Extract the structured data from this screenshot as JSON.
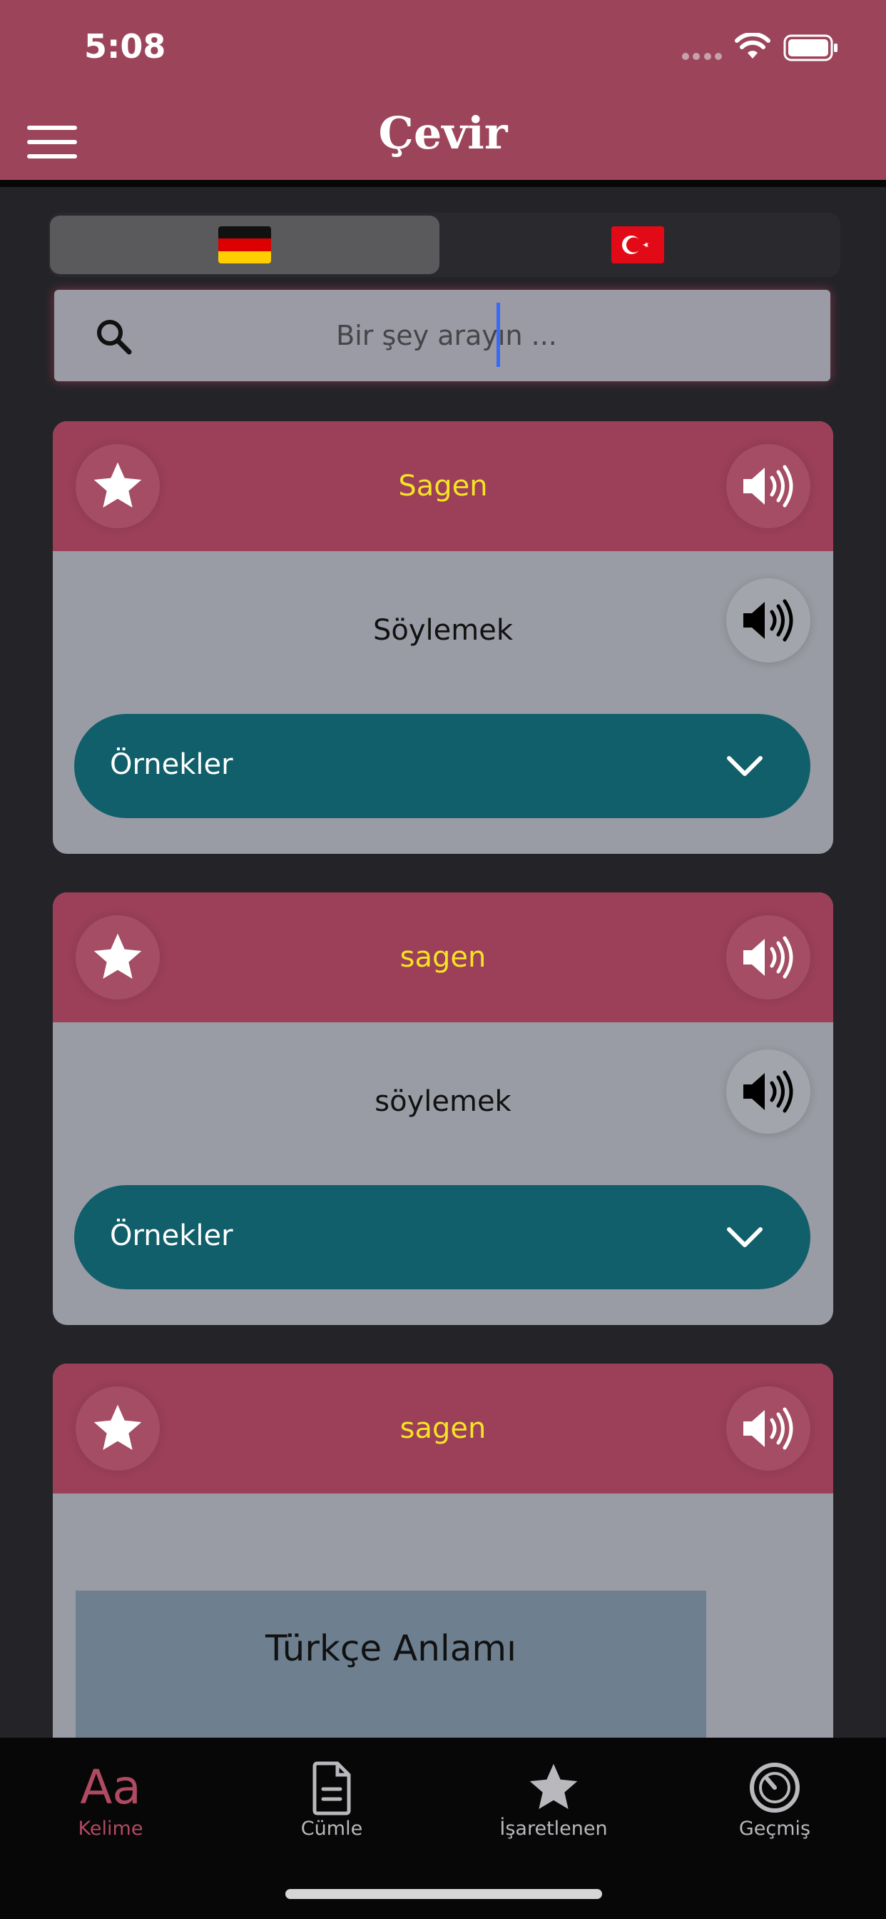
{
  "status_bar": {
    "time": "5:08"
  },
  "header": {
    "title": "Çevir"
  },
  "language_toggle": {
    "options": [
      {
        "name": "German",
        "flag": "flag-de-icon",
        "selected": true
      },
      {
        "name": "Turkish",
        "flag": "flag-tr-icon",
        "selected": false
      }
    ]
  },
  "search": {
    "placeholder": "Bir şey arayın ...",
    "value": ""
  },
  "results": [
    {
      "word": "Sagen",
      "meaning": "Söylemek",
      "examples_label": "Örnekler"
    },
    {
      "word": "sagen",
      "meaning": "söylemek",
      "examples_label": "Örnekler"
    },
    {
      "word": "sagen",
      "meaning_box_label": "Türkçe Anlamı"
    }
  ],
  "tabbar": {
    "tabs": [
      {
        "label": "Kelime",
        "icon": "text-aa-icon",
        "active": true
      },
      {
        "label": "Cümle",
        "icon": "document-icon",
        "active": false
      },
      {
        "label": "İşaretlenen",
        "icon": "star-icon",
        "active": false
      },
      {
        "label": "Geçmiş",
        "icon": "history-icon",
        "active": false
      }
    ]
  },
  "colors": {
    "header": "#9c445a",
    "background": "#242428",
    "card_body": "#9a9ca5",
    "word_text": "#f5e325",
    "examples_bar": "#105f6a",
    "active_tab": "#b04a63"
  }
}
